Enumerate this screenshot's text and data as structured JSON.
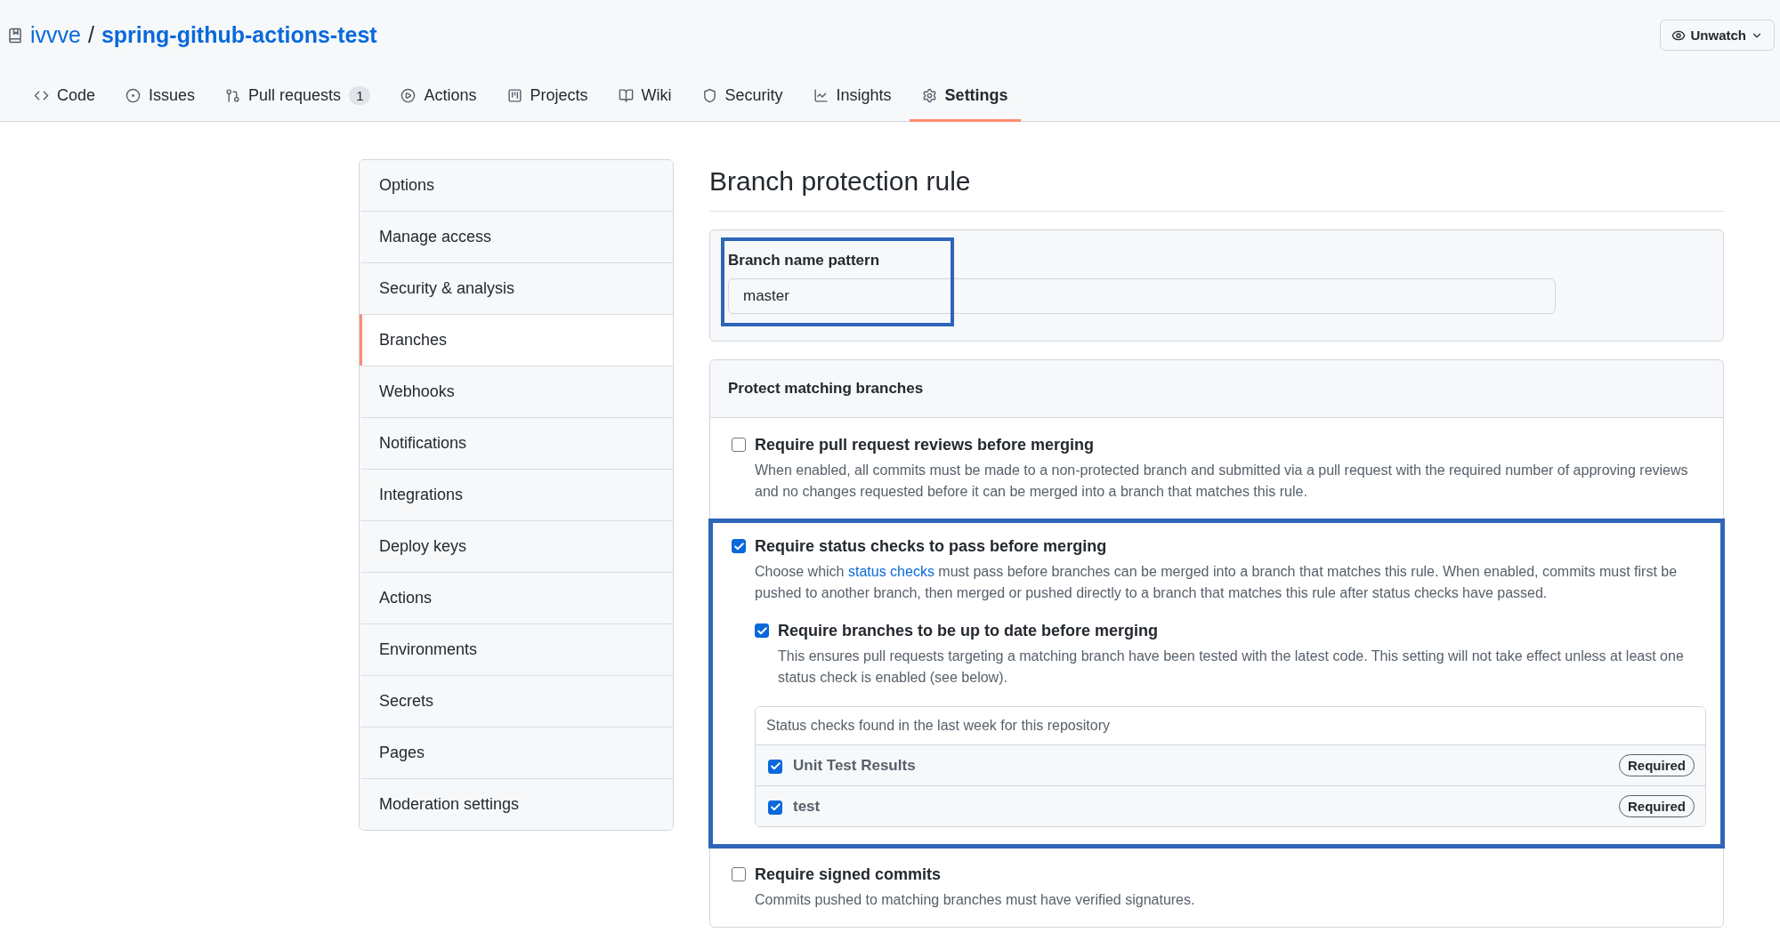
{
  "repo": {
    "owner": "ivvve",
    "separator": "/",
    "name": "spring-github-actions-test"
  },
  "watch_button": {
    "label": "Unwatch"
  },
  "tabs": [
    {
      "label": "Code",
      "selected": false
    },
    {
      "label": "Issues",
      "selected": false
    },
    {
      "label": "Pull requests",
      "counter": "1",
      "selected": false
    },
    {
      "label": "Actions",
      "selected": false
    },
    {
      "label": "Projects",
      "selected": false
    },
    {
      "label": "Wiki",
      "selected": false
    },
    {
      "label": "Security",
      "selected": false
    },
    {
      "label": "Insights",
      "selected": false
    },
    {
      "label": "Settings",
      "selected": true
    }
  ],
  "sidebar": {
    "items": [
      {
        "label": "Options",
        "selected": false
      },
      {
        "label": "Manage access",
        "selected": false
      },
      {
        "label": "Security & analysis",
        "selected": false
      },
      {
        "label": "Branches",
        "selected": true
      },
      {
        "label": "Webhooks",
        "selected": false
      },
      {
        "label": "Notifications",
        "selected": false
      },
      {
        "label": "Integrations",
        "selected": false
      },
      {
        "label": "Deploy keys",
        "selected": false
      },
      {
        "label": "Actions",
        "selected": false
      },
      {
        "label": "Environments",
        "selected": false
      },
      {
        "label": "Secrets",
        "selected": false
      },
      {
        "label": "Pages",
        "selected": false
      },
      {
        "label": "Moderation settings",
        "selected": false
      }
    ]
  },
  "page_title": "Branch protection rule",
  "pattern": {
    "label": "Branch name pattern",
    "value": "master",
    "highlighted": true
  },
  "protect": {
    "heading": "Protect matching branches",
    "options": [
      {
        "title": "Require pull request reviews before merging",
        "checked": false,
        "highlighted": false,
        "description": "When enabled, all commits must be made to a non-protected branch and submitted via a pull request with the required number of approving reviews and no changes requested before it can be merged into a branch that matches this rule."
      },
      {
        "title": "Require status checks to pass before merging",
        "checked": true,
        "highlighted": true,
        "description_before": "Choose which",
        "link": "status checks",
        "description_after": "must pass before branches can be merged into a branch that matches this rule. When enabled, commits must first be pushed to another branch, then merged or pushed directly to a branch that matches this rule after status checks have passed.",
        "sub_option": {
          "title": "Require branches to be up to date before merging",
          "checked": true,
          "description": "This ensures pull requests targeting a matching branch have been tested with the latest code. This setting will not take effect unless at least one status check is enabled (see below)."
        },
        "checks": {
          "heading": "Status checks found in the last week for this repository",
          "items": [
            {
              "name": "Unit Test Results",
              "checked": true,
              "badge": "Required"
            },
            {
              "name": "test",
              "checked": true,
              "badge": "Required"
            }
          ]
        }
      },
      {
        "title": "Require signed commits",
        "checked": false,
        "highlighted": false,
        "description": "Commits pushed to matching branches must have verified signatures."
      }
    ]
  }
}
